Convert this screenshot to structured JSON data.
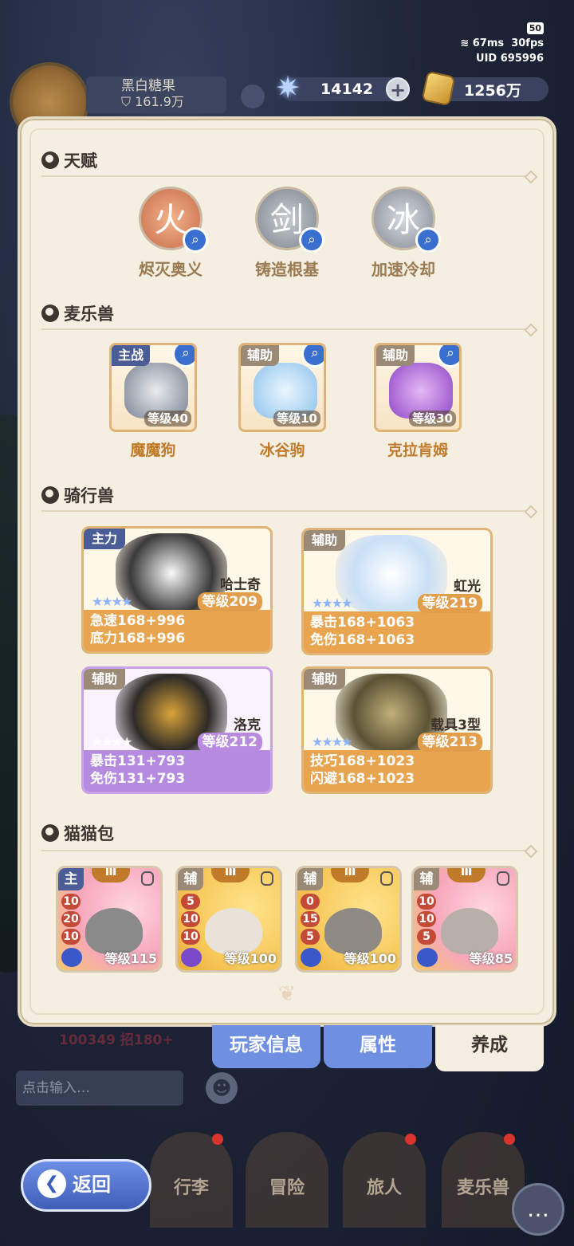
{
  "status": {
    "battery": "50",
    "ping": "67ms",
    "fps": "30fps",
    "uid": "UID 695996"
  },
  "player": {
    "name": "黑白糖果",
    "power": "161.9万"
  },
  "resources": {
    "crystal": "14142",
    "gold": "1256万"
  },
  "sections": {
    "talent": "天赋",
    "pets": "麦乐兽",
    "mounts": "骑行兽",
    "cats": "猫猫包"
  },
  "talents": [
    {
      "label": "烬灭奥义",
      "glyph": "火"
    },
    {
      "label": "铸造根基",
      "glyph": "剑"
    },
    {
      "label": "加速冷却",
      "glyph": "冰"
    }
  ],
  "pets": [
    {
      "tag": "主战",
      "level": "等级40",
      "name": "魔魔狗"
    },
    {
      "tag": "辅助",
      "level": "等级10",
      "name": "冰谷驹"
    },
    {
      "tag": "辅助",
      "level": "等级30",
      "name": "克拉肯姆"
    }
  ],
  "mounts": [
    {
      "tag": "主力",
      "name": "哈士奇",
      "stars": "★★★★",
      "level": "等级209",
      "stat1": "急速168+996",
      "stat2": "底力168+996"
    },
    {
      "tag": "辅助",
      "name": "虹光",
      "stars": "★★★★",
      "level": "等级219",
      "stat1": "暴击168+1063",
      "stat2": "免伤168+1063"
    },
    {
      "tag": "辅助",
      "name": "洛克",
      "stars": "★★★★",
      "level": "等级212",
      "stat1": "暴击131+793",
      "stat2": "免伤131+793"
    },
    {
      "tag": "辅助",
      "name": "载具3型",
      "stars": "★★★★",
      "level": "等级213",
      "stat1": "技巧168+1023",
      "stat2": "闪避168+1023"
    }
  ],
  "cats": [
    {
      "rank": "Ⅲ",
      "tag": "主",
      "nums": [
        "10",
        "20",
        "10"
      ],
      "level": "等级115"
    },
    {
      "rank": "Ⅲ",
      "tag": "辅",
      "nums": [
        "5",
        "10",
        "10"
      ],
      "level": "等级100"
    },
    {
      "rank": "Ⅲ",
      "tag": "辅",
      "nums": [
        "0",
        "15",
        "5"
      ],
      "level": "等级100"
    },
    {
      "rank": "Ⅲ",
      "tag": "辅",
      "nums": [
        "10",
        "10",
        "5"
      ],
      "level": "等级85"
    }
  ],
  "footer_stat": "100349 招180+",
  "tabs": [
    "玩家信息",
    "属性",
    "养成"
  ],
  "chat_placeholder": "点击输入…",
  "nav": [
    "行李",
    "冒险",
    "旅人",
    "麦乐兽"
  ],
  "back_label": "返回"
}
